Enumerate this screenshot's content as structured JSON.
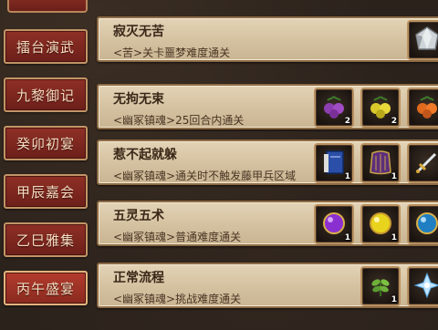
{
  "sidebar": {
    "tabs": [
      {
        "label": "擂台演武"
      },
      {
        "label": "九黎御记"
      },
      {
        "label": "癸卯初宴"
      },
      {
        "label": "甲辰嘉会"
      },
      {
        "label": "乙巳雅集"
      },
      {
        "label": "丙午盛宴"
      }
    ],
    "active_index": 5
  },
  "achievements": [
    {
      "title": "寂灭无苦",
      "desc": "<苦>关卡噩梦难度通关",
      "rewards": [
        {
          "icon": "silver-gem-icon",
          "count": ""
        }
      ]
    },
    {
      "title": "无拘无束",
      "desc": "<幽冢镇魂>25回合内通关",
      "rewards": [
        {
          "icon": "purple-fruit-icon",
          "count": "2"
        },
        {
          "icon": "yellow-fruit-icon",
          "count": "2"
        },
        {
          "icon": "orange-fruit-icon",
          "count": ""
        }
      ]
    },
    {
      "title": "惹不起就躲",
      "desc": "<幽冢镇魂>通关时不触发藤甲兵区域",
      "rewards": [
        {
          "icon": "blue-book-icon",
          "count": "1"
        },
        {
          "icon": "purple-armor-icon",
          "count": "1"
        },
        {
          "icon": "gold-sword-icon",
          "count": ""
        }
      ]
    },
    {
      "title": "五灵五术",
      "desc": "<幽冢镇魂>普通难度通关",
      "rewards": [
        {
          "icon": "purple-orb-icon",
          "count": "1"
        },
        {
          "icon": "yellow-orb-icon",
          "count": "1"
        },
        {
          "icon": "blue-orb-icon",
          "count": ""
        }
      ]
    },
    {
      "title": "正常流程",
      "desc": "<幽冢镇魂>挑战难度通关",
      "rewards": [
        {
          "icon": "green-herb-icon",
          "count": "1"
        },
        {
          "icon": "ice-crystal-icon",
          "count": ""
        }
      ]
    }
  ],
  "colors": {
    "tab_red": "#8f3026",
    "tab_border": "#c29466",
    "row_parchment": "#d4c1a0",
    "title_text": "#3a2718"
  }
}
